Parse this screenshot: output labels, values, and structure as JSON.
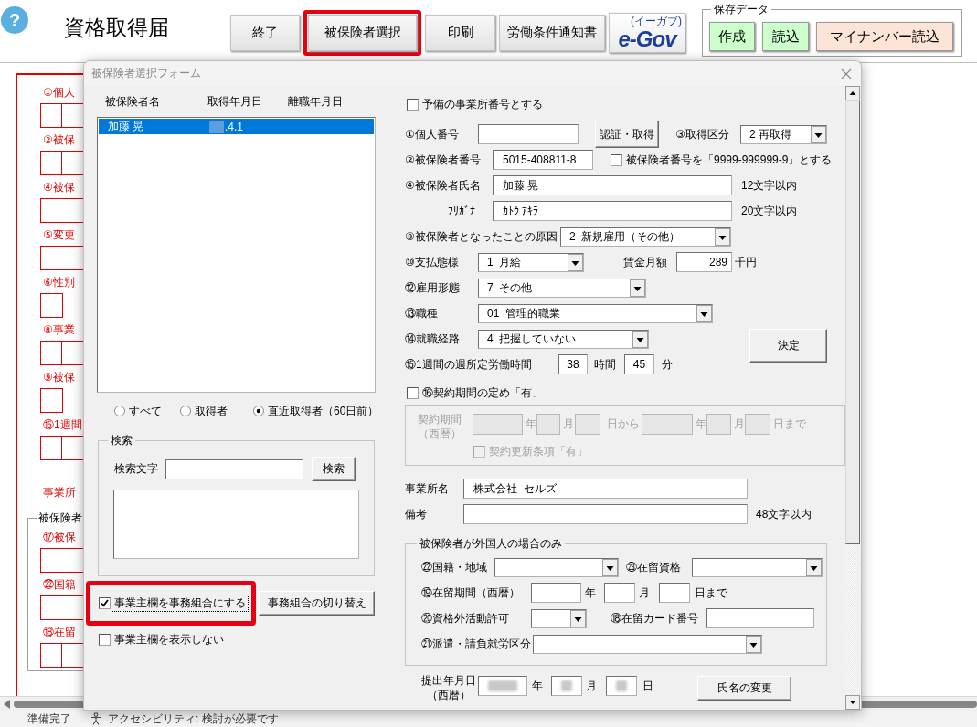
{
  "toolbar": {
    "help": "?",
    "title": "資格取得届",
    "buttons": [
      {
        "label": "終了",
        "highlighted": false
      },
      {
        "label": "被保険者選択",
        "highlighted": true
      },
      {
        "label": "印刷",
        "highlighted": false
      },
      {
        "label": "労働条件通知書",
        "highlighted": false
      }
    ],
    "egov": {
      "logo": "e-Gov",
      "reading": "(イーガブ)"
    },
    "save_data": {
      "title": "保存データ",
      "buttons": [
        {
          "label": "作成",
          "color": "#ccffcc"
        },
        {
          "label": "読込",
          "color": "#ccffcc"
        },
        {
          "label": "マイナンバー読込",
          "color": "#fce4d6"
        }
      ]
    }
  },
  "sheet": {
    "items": [
      {
        "label": "①個人",
        "kind": "pair"
      },
      {
        "label": "②被保",
        "kind": "pair"
      },
      {
        "label": "④被保",
        "kind": "wide"
      },
      {
        "label": "⑤変更",
        "kind": "wide"
      },
      {
        "label": "⑥性別",
        "kind": "single"
      },
      {
        "label": "⑧事業",
        "kind": "pair"
      },
      {
        "label": "⑨被保",
        "kind": "single"
      },
      {
        "label": "⑮1週間",
        "kind": "pair"
      },
      {
        "label": "事業所",
        "kind": "heading"
      }
    ],
    "group": {
      "title": "被保険者",
      "items": [
        {
          "label": "⑰被保",
          "kind": "wide"
        },
        {
          "label": "㉒国籍",
          "kind": "wide"
        },
        {
          "label": "⑱在留",
          "kind": "pair"
        }
      ]
    }
  },
  "dialog": {
    "title": "被保険者選択フォーム",
    "list": {
      "columns": [
        "被保険者名",
        "取得年月日",
        "離職年月日"
      ],
      "rows": [
        {
          "name": "加藤 晃",
          "acquired": ".4.1",
          "redacted": true,
          "selected": true
        }
      ]
    },
    "filters": [
      {
        "label": "すべて",
        "selected": false
      },
      {
        "label": "取得者",
        "selected": false
      },
      {
        "label": "直近取得者（60日前）",
        "selected": true
      }
    ],
    "search": {
      "title": "検索",
      "label": "検索文字",
      "button": "検索"
    },
    "options": [
      {
        "label": "事業主欄を事務組合にする",
        "checked": true,
        "focused": true,
        "highlighted": true
      },
      {
        "label": "事業主欄を表示しない",
        "checked": false,
        "focused": false,
        "highlighted": false
      }
    ],
    "switch_button": "事務組合の切り替え",
    "form": {
      "spare": {
        "label": "予備の事業所番号とする",
        "checked": false
      },
      "personal_number": {
        "label": "①個人番号"
      },
      "auth_button": "認証・取得",
      "acquisition_type": {
        "label": "③取得区分",
        "value": "2 再取得"
      },
      "insured_number": {
        "label": "②被保険者番号",
        "value": "5015-408811-8"
      },
      "dummy_number": {
        "label": "被保険者番号を「9999-999999-9」とする",
        "checked": false
      },
      "name": {
        "label": "④被保険者氏名",
        "value": "加藤 晃",
        "note": "12文字以内"
      },
      "furigana": {
        "label": "ﾌﾘｶﾞﾅ",
        "value": "ｶﾄｳ ｱｷﾗ",
        "note": "20文字以内"
      },
      "cause": {
        "label": "⑨被保険者となったことの原因",
        "value": "2  新規雇用（その他）"
      },
      "payment": {
        "label": "⑩支払態様",
        "value": "1  月給"
      },
      "wage": {
        "label": "賃金月額",
        "value": "289",
        "unit": "千円"
      },
      "employment": {
        "label": "⑫雇用形態",
        "value": "7  その他"
      },
      "occupation": {
        "label": "⑬職種",
        "value": "01  管理的職業"
      },
      "route": {
        "label": "⑭就職経路",
        "value": "4  把握していない"
      },
      "decide_button": "決定",
      "hours": {
        "label": "⑮1週間の週所定労働時間",
        "hours": "38",
        "hours_unit": "時間",
        "minutes": "45",
        "minutes_unit": "分"
      },
      "contract": {
        "label": "⑯契約期間の定め「有」",
        "checked": false,
        "period": {
          "disabled": true,
          "label": "契約期間",
          "sub_label": "（西暦）",
          "from": {
            "year_unit": "年",
            "month_unit": "月",
            "day_unit": "日から"
          },
          "to": {
            "year_unit": "年",
            "month_unit": "月",
            "day_unit": "日まで"
          },
          "renewal": {
            "label": "契約更新条項「有」",
            "checked": false
          }
        }
      },
      "office": {
        "label": "事業所名",
        "value": "株式会社  セルズ"
      },
      "remarks": {
        "label": "備考",
        "note": "48文字以内"
      },
      "foreign": {
        "title": "被保険者が外国人の場合のみ",
        "nationality": {
          "label": "㉒国籍・地域"
        },
        "status": {
          "label": "㉓在留資格"
        },
        "period": {
          "label": "⑲在留期間（西暦）",
          "year_unit": "年",
          "month_unit": "月",
          "day_unit": "日まで"
        },
        "work_permit": {
          "label": "⑳資格外活動許可"
        },
        "card_number": {
          "label": "⑱在留カード番号"
        },
        "dispatch": {
          "label": "㉑派遣・請負就労区分"
        }
      },
      "submission": {
        "label": "提出年月日",
        "sub_label": "（西暦）",
        "year_unit": "年",
        "month_unit": "月",
        "day_unit": "日",
        "redacted": true
      },
      "rename_button": "氏名の変更"
    }
  },
  "status_bar": {
    "status": "準備完了",
    "accessibility": "アクセシビリティ: 検討が必要です"
  }
}
